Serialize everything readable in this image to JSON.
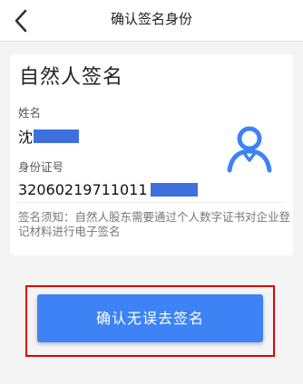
{
  "header": {
    "title": "确认签名身份",
    "back_icon": "chevron-left-icon"
  },
  "card": {
    "title": "自然人签名",
    "name_label": "姓名",
    "name_value": "沈",
    "id_label": "身份证号",
    "id_value": "32060219711011",
    "avatar_icon": "user-icon",
    "notice": "签名须知：自然人股东需要通过个人数字证书对企业登记材料进行电子签名"
  },
  "actions": {
    "confirm_label": "确认无误去签名"
  },
  "colors": {
    "accent": "#3d83f5",
    "redaction": "#3f6fdc",
    "highlight_frame": "#e00000"
  }
}
